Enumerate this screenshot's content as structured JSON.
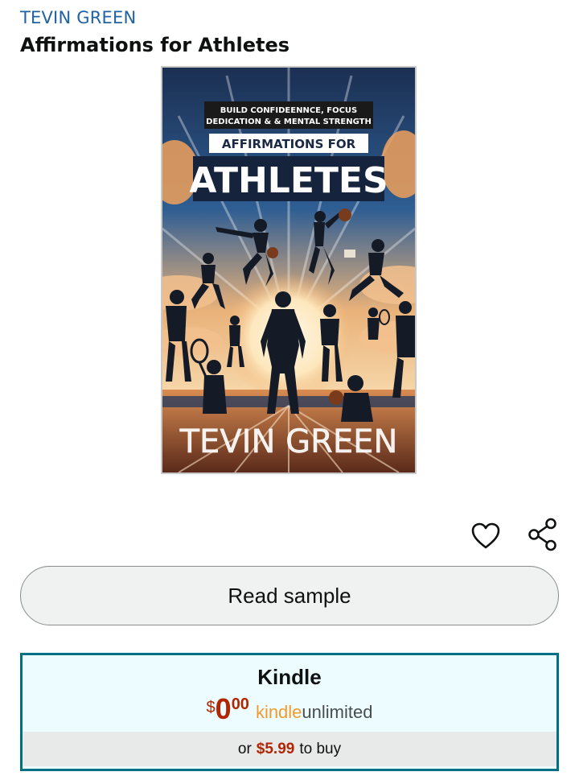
{
  "product": {
    "author": "TEVIN GREEN",
    "title": "Affirmations for Athletes"
  },
  "cover": {
    "tagline_line1": "BUILD CONFIDEENNCE,  FOCUS",
    "tagline_line2": "DEDICATION & & MENTAL STRENGTH",
    "banner_small": "AFFIRMATIONS FOR",
    "banner_large": "ATHLETES",
    "author_text": "TEVIN GREEN"
  },
  "actions": {
    "wishlist_icon": "heart-outline-icon",
    "share_icon": "share-icon",
    "read_sample_label": "Read sample"
  },
  "format": {
    "name": "Kindle",
    "currency": "$",
    "price_whole": "0",
    "price_fraction": "00",
    "ku_kindle": "kindle",
    "ku_unlimited": "unlimited",
    "buy_prefix": "or",
    "buy_price": "$5.99",
    "buy_suffix": "to buy"
  },
  "colors": {
    "link": "#2162a1",
    "price": "#b12704",
    "format_border": "#007185",
    "format_bg": "#edfdff",
    "kindle_orange": "#f29a2b"
  }
}
